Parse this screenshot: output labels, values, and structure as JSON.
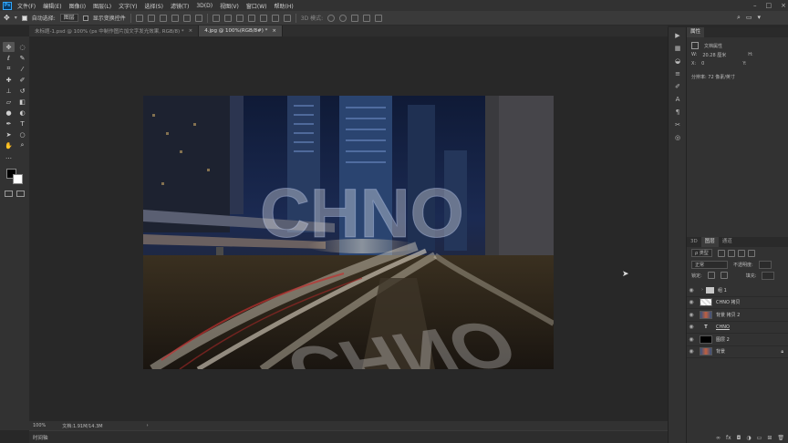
{
  "menu": {
    "items": [
      "文件(F)",
      "编辑(E)",
      "图像(I)",
      "图层(L)",
      "文字(Y)",
      "选择(S)",
      "滤镜(T)",
      "3D(D)",
      "视图(V)",
      "窗口(W)",
      "帮助(H)"
    ]
  },
  "options": {
    "auto_select_label": "自动选择:",
    "auto_select_target": "图层",
    "show_transform_label": "显示变换控件",
    "mode_label": "3D 模式:"
  },
  "tabs": [
    {
      "label": "未标题-1.psd @ 100% (ps 中制作图片加文字发光效果, RGB/8) *",
      "close": "×"
    },
    {
      "label": "4.jpg @ 100%(RGB/8#) *",
      "close": "×"
    }
  ],
  "status": {
    "zoom": "100%",
    "doc_info": "文档:1.91M/14.3M",
    "arrow": "›"
  },
  "timeline": {
    "label": "时间轴"
  },
  "properties": {
    "tabs": [
      "属性"
    ],
    "title": "文档属性",
    "w_label": "W:",
    "w_value": "20.28 厘米",
    "h_label": "H:",
    "x_label": "X:",
    "x_value": "0",
    "y_label": "Y:",
    "resolution": "分辨率: 72 像素/英寸"
  },
  "layers_panel": {
    "tabs": [
      "3D",
      "图层",
      "通道"
    ],
    "filter_label": "ρ 类型",
    "blend_mode": "正常",
    "opacity_label": "不透明度:",
    "lock_label": "锁定:",
    "fill_label": "填充:",
    "layers": [
      {
        "name": "组 1",
        "kind": "group"
      },
      {
        "name": "CHNO 拷贝",
        "kind": "pattern"
      },
      {
        "name": "背景 拷贝 2",
        "kind": "photo"
      },
      {
        "name": "CHNO",
        "kind": "text"
      },
      {
        "name": "图层 2",
        "kind": "black"
      },
      {
        "name": "背景",
        "kind": "photo",
        "locked": true
      }
    ]
  },
  "document": {
    "overlay_text_top": "CHNO",
    "overlay_text_bottom": "CHNO"
  },
  "colors": {
    "ps_blue": "#31a8ff",
    "panel": "#323232",
    "canvas_bg": "#282828"
  }
}
